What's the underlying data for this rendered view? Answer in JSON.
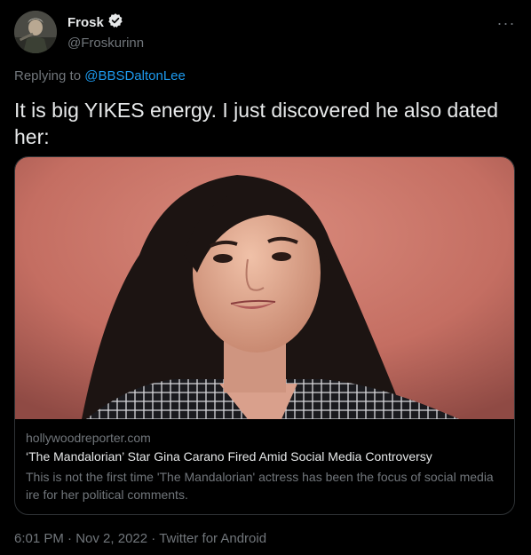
{
  "author": {
    "name": "Frosk",
    "handle": "@Froskurinn",
    "verified_icon": "verified-badge-icon",
    "more_icon": "more-options-icon"
  },
  "reply": {
    "prefix": "Replying to",
    "mention": "@BBSDaltonLee"
  },
  "tweet": {
    "text": "It is big YIKES energy. I just discovered he also dated her:"
  },
  "card": {
    "domain": "hollywoodreporter.com",
    "title": "‘The Mandalorian’ Star Gina Carano Fired Amid Social Media Controversy",
    "description": "This is not the first time 'The Mandalorian' actress has been the focus of social media ire for her political comments."
  },
  "meta": {
    "time": "6:01 PM",
    "separator": "·",
    "date": "Nov 2, 2022",
    "source": "Twitter for Android"
  },
  "colors": {
    "background": "#000000",
    "text": "#e7e9ea",
    "muted": "#71767b",
    "link": "#1d9bf0",
    "border": "#2f3336"
  }
}
